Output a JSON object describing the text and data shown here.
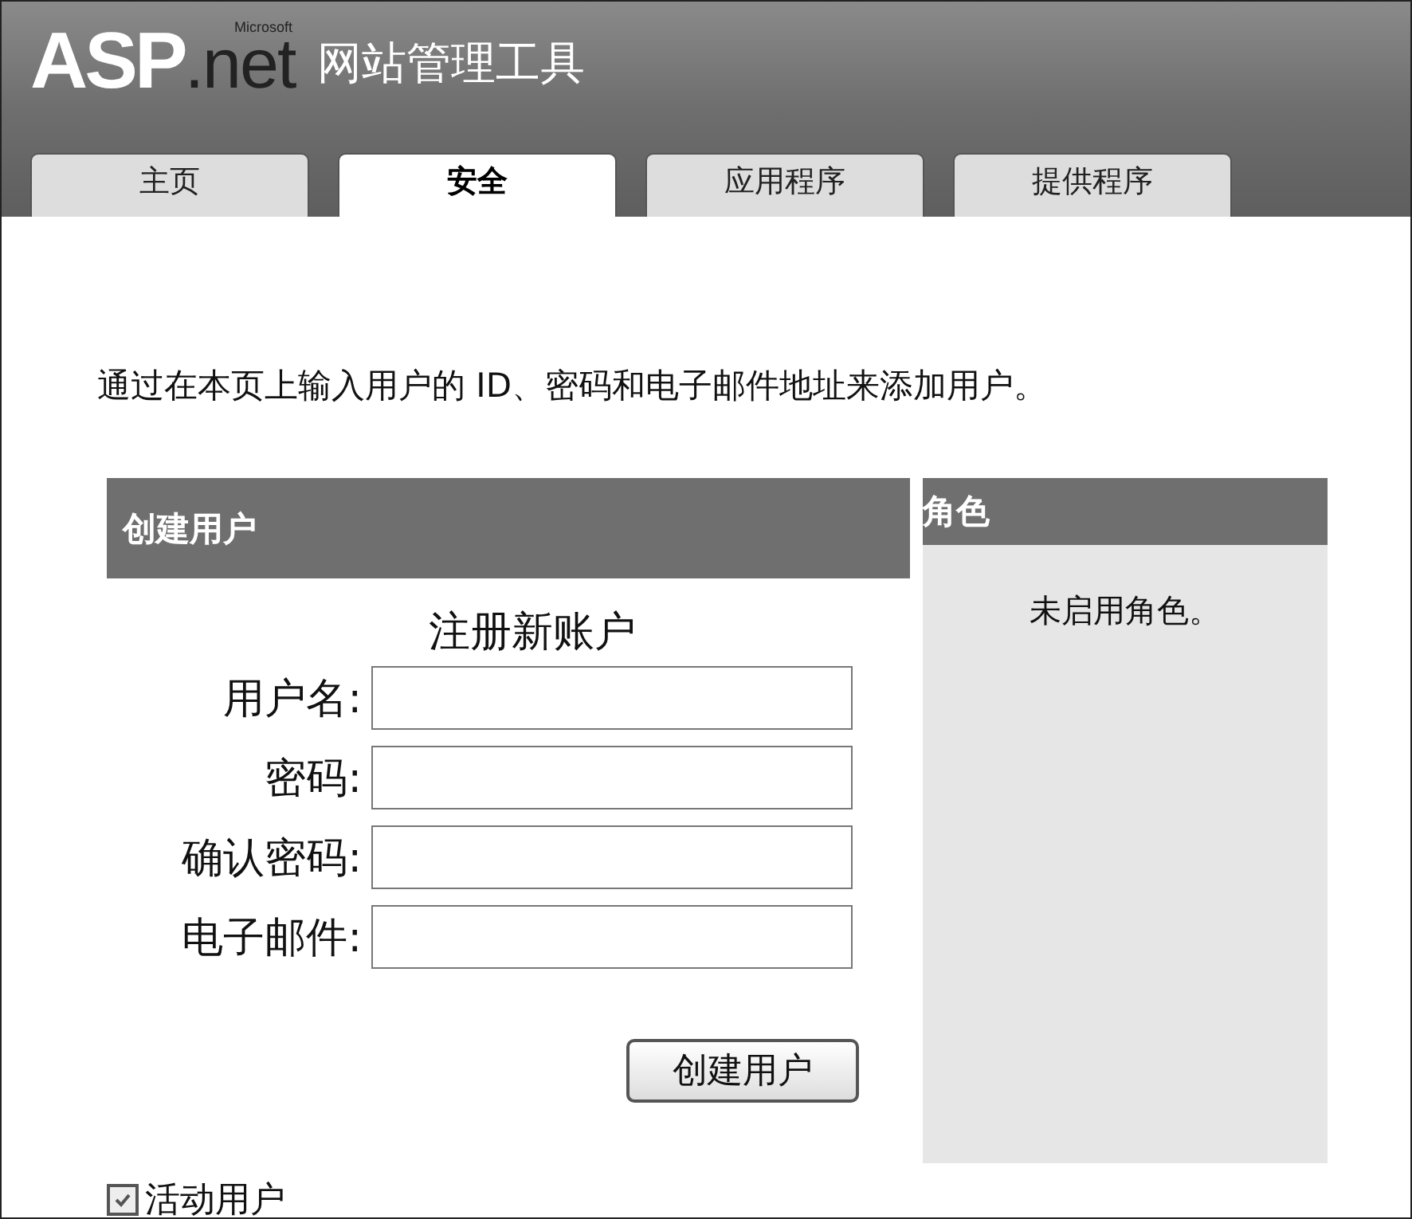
{
  "logo": {
    "brand": "ASP",
    "suffix": ".net",
    "maker": "Microsoft",
    "title": "网站管理工具"
  },
  "tabs": [
    {
      "label": "主页",
      "selected": false
    },
    {
      "label": "安全",
      "selected": true
    },
    {
      "label": "应用程序",
      "selected": false
    },
    {
      "label": "提供程序",
      "selected": false
    }
  ],
  "intro": "通过在本页上输入用户的 ID、密码和电子邮件地址来添加用户。",
  "create_user": {
    "header": "创建用户",
    "subtitle": "注册新账户",
    "fields": [
      {
        "label": "用户名:"
      },
      {
        "label": "密码:"
      },
      {
        "label": "确认密码:"
      },
      {
        "label": "电子邮件:"
      }
    ],
    "button": "创建用户",
    "active": {
      "label": "活动用户",
      "checked": true
    }
  },
  "roles": {
    "header": "角色",
    "message": "未启用角色。"
  }
}
